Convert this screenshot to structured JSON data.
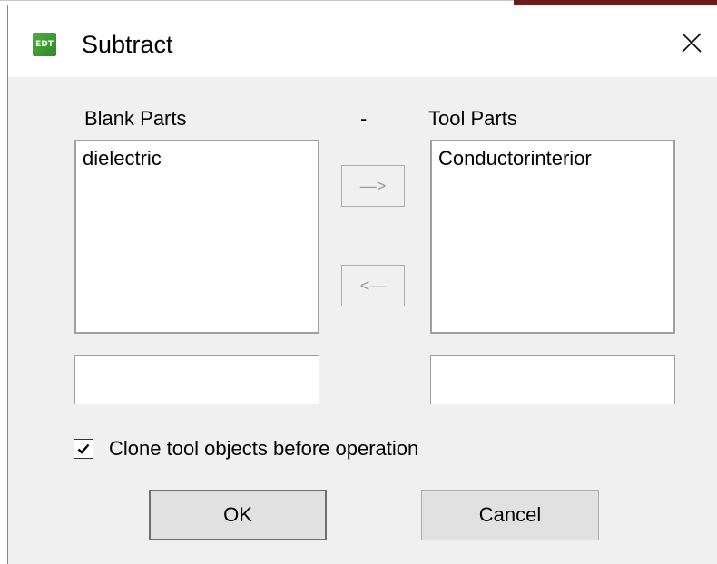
{
  "dialog": {
    "title": "Subtract",
    "app_icon_text": "EDT",
    "close_icon": "close-icon"
  },
  "blank_parts": {
    "label": "Blank Parts",
    "items": [
      "dielectric"
    ],
    "filter_value": ""
  },
  "separator_label": "-",
  "tool_parts": {
    "label": "Tool Parts",
    "items": [
      "Conductorinterior"
    ],
    "filter_value": ""
  },
  "move_buttons": {
    "to_tool": "—>",
    "to_blank": "<—"
  },
  "clone_option": {
    "label": "Clone tool objects before operation",
    "checked": true
  },
  "buttons": {
    "ok": "OK",
    "cancel": "Cancel"
  },
  "colors": {
    "dialog_bg": "#f0f0f0",
    "icon_green": "#3a9a30",
    "accent_dark_red": "#6e1b1b"
  }
}
